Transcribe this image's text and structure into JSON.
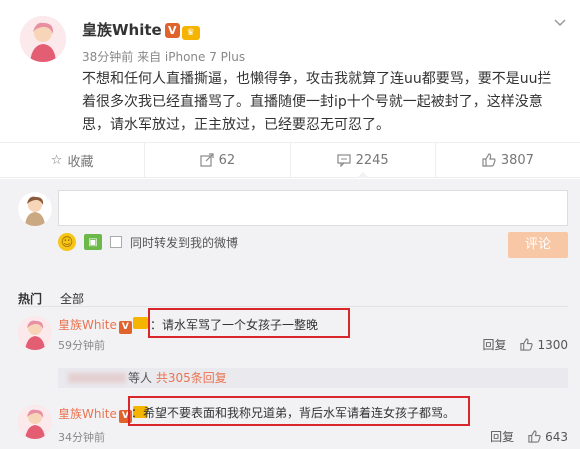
{
  "post": {
    "username": "皇族White",
    "v_badge": "V",
    "meta": "38分钟前 来自 iPhone 7 Plus",
    "text": "不想和任何人直播撕逼，也懒得争，攻击我就算了连uu都要骂，要不是uu拦着很多次我已经直播骂了。直播随便一封ip十个号就一起被封了，这样没意思，请水军放过，正主放过，已经要忍无可忍了。",
    "dropdown_icon": "chevron-down-icon"
  },
  "actions": {
    "favorite_label": "收藏",
    "repost_count": "62",
    "comment_count": "2245",
    "like_count": "3807"
  },
  "composer": {
    "placeholder": "",
    "sync_label": "同时转发到我的微博",
    "submit_label": "评论"
  },
  "tabs": {
    "hot": "热门",
    "all": "全部"
  },
  "comments": [
    {
      "username": "皇族White",
      "v_badge": "V",
      "text": "：请水军骂了一个女孩子一整晚",
      "time": "59分钟前",
      "reply_label": "回复",
      "likes": "1300"
    },
    {
      "username": "皇族White",
      "v_badge": "V",
      "text": "：希望不要表面和我称兄道弟，背后水军请着连女孩子都骂。",
      "time": "34分钟前",
      "reply_label": "回复",
      "likes": "643"
    }
  ],
  "more_replies": {
    "suffix": "等人",
    "link": "共305条回复"
  },
  "colors": {
    "accent": "#eb7350",
    "highlight_box": "#d9262b",
    "submit_bg": "#f8c7a6"
  }
}
